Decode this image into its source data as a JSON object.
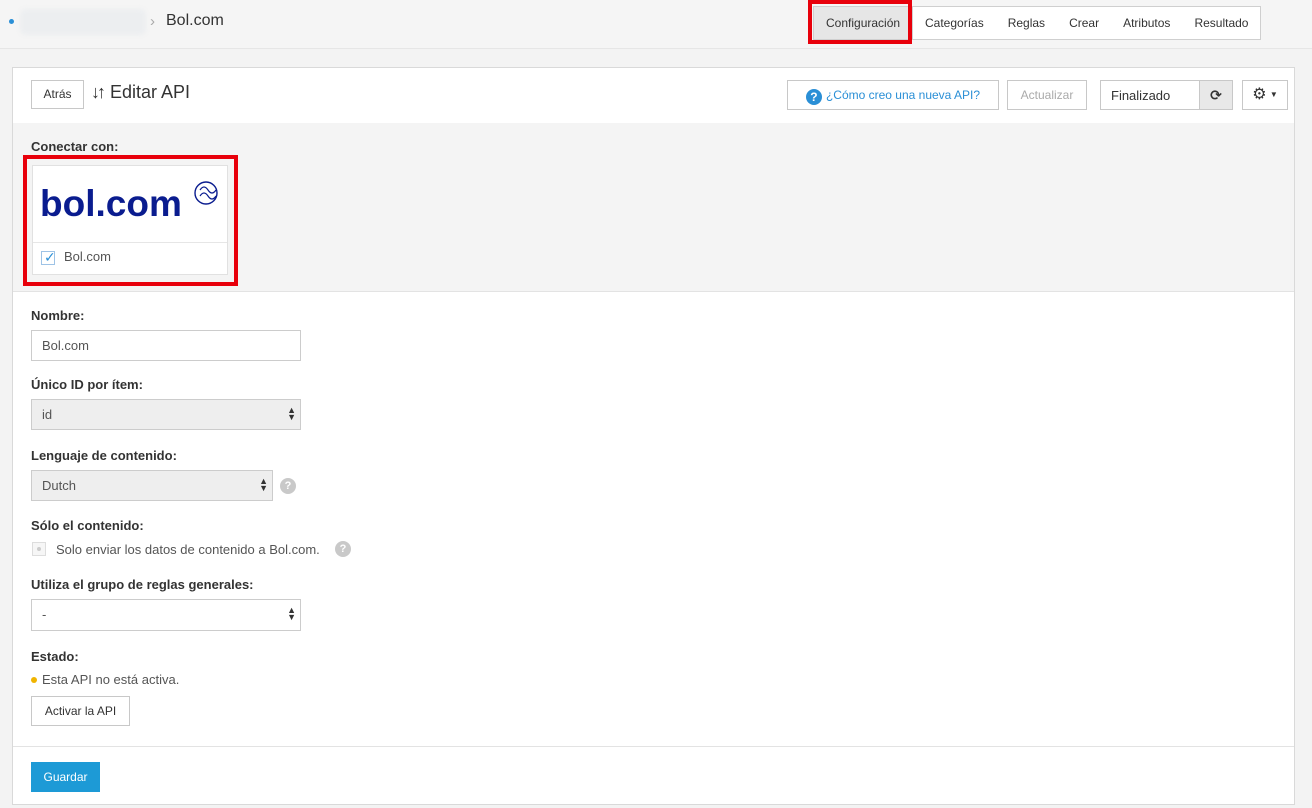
{
  "breadcrumb": {
    "title": "Bol.com"
  },
  "tabs": [
    {
      "label": "Configuración"
    },
    {
      "label": "Categorías"
    },
    {
      "label": "Reglas"
    },
    {
      "label": "Crear"
    },
    {
      "label": "Atributos"
    },
    {
      "label": "Resultado"
    }
  ],
  "header": {
    "back_label": "Atrás",
    "title": "Editar API",
    "help_label": "¿Cómo creo una nueva API?",
    "update_label": "Actualizar",
    "status_value": "Finalizado"
  },
  "connect": {
    "label": "Conectar con:",
    "logo_text": "bol.com",
    "option_name": "Bol.com",
    "checked": true
  },
  "form": {
    "name_label": "Nombre:",
    "name_value": "Bol.com",
    "unique_id_label": "Único ID por ítem:",
    "unique_id_value": "id",
    "language_label": "Lenguaje de contenido:",
    "language_value": "Dutch",
    "content_only_label": "Sólo el contenido:",
    "content_only_text": "Solo enviar los datos de contenido a Bol.com.",
    "rules_group_label": "Utiliza el grupo de reglas generales:",
    "rules_group_value": "-",
    "state_label": "Estado:",
    "state_text": "Esta API no está activa.",
    "activate_label": "Activar la API"
  },
  "footer": {
    "save_label": "Guardar"
  },
  "colors": {
    "accent": "#1d9ad6",
    "highlight": "#e8000b",
    "warning": "#f0b400"
  }
}
